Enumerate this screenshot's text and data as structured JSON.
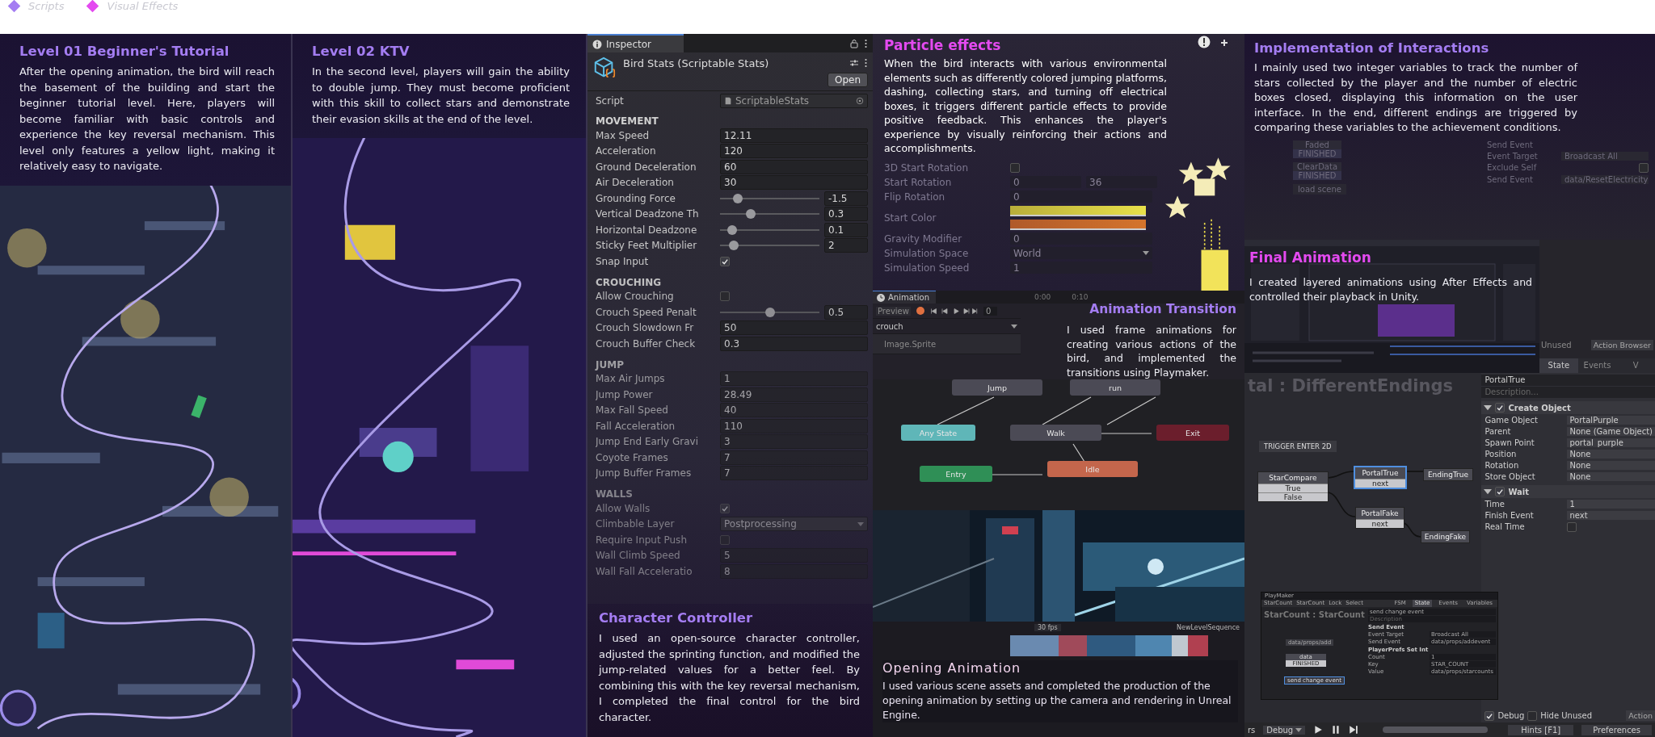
{
  "legend": [
    {
      "label": "Scripts",
      "color": "#a47df2"
    },
    {
      "label": "Visual Effects",
      "color": "#e44af0"
    }
  ],
  "notes": [
    {
      "title": "Level 01 Beginner's Tutorial",
      "color": "#a47df2",
      "body": "After the opening animation, the bird will reach the basement of the building and start the beginner tutorial level. Here, players will become familiar with basic controls and experience the key reversal mechanism. This level only features a yellow light, making it relatively easy to navigate."
    },
    {
      "title": "Level 02 KTV",
      "color": "#a47df2",
      "body": "In the second level, players will gain the ability to double jump. They must become proficient with this skill to collect stars and demonstrate their evasion skills at the end of the level."
    },
    {
      "title": "Character Controller",
      "color": "#a47df2",
      "body": "I used an open-source character controller, adjusted the sprinting function, and modified the jump-related values for a better feel. By combining this with the key reversal mechanism, I completed the final control for the bird character."
    },
    {
      "title": "Particle effects",
      "color": "#e44af0",
      "body": "When the bird interacts with various environmental elements such as differently colored jumping platforms, dashing, collecting stars, and turning off electrical boxes, it triggers different particle effects to provide positive feedback. This enhances the player's experience by visually reinforcing their actions and accomplishments."
    },
    {
      "title": "Animation Transition",
      "color": "#a47df2",
      "body": "I used frame animations for creating various actions of the bird, and implemented the transitions using Playmaker."
    },
    {
      "title": "Opening Animation",
      "color": "#f2d4ee",
      "body": "I used various scene assets and completed the production of the opening animation by setting up the camera and rendering in Unreal Engine."
    },
    {
      "title": "Implementation of Interactions",
      "color": "#a47df2",
      "body": "I mainly used two integer variables to track the number of stars collected by the player and the number of electric boxes closed, displaying this information on the user interface. In the end, different endings are triggered by comparing these variables to the achievement conditions."
    },
    {
      "title": "Final Animation",
      "color": "#e44af0",
      "body": "I created layered animations using After Effects and controlled their playback in Unity."
    }
  ],
  "inspector": {
    "tab": "Inspector",
    "asset": "Bird Stats (Scriptable Stats)",
    "open_button": "Open",
    "script_label": "Script",
    "script_value": "ScriptableStats",
    "groups": [
      {
        "heading": "MOVEMENT",
        "rows": [
          {
            "label": "Max Speed",
            "kind": "field",
            "value": "12.11"
          },
          {
            "label": "Acceleration",
            "kind": "field",
            "value": "120"
          },
          {
            "label": "Ground Deceleration",
            "kind": "field",
            "value": "60"
          },
          {
            "label": "Air Deceleration",
            "kind": "field",
            "value": "30"
          },
          {
            "label": "Grounding Force",
            "kind": "slider",
            "level": 0.18,
            "value": "-1.5"
          },
          {
            "label": "Vertical Deadzone Th",
            "kind": "slider",
            "level": 0.31,
            "value": "0.3"
          },
          {
            "label": "Horizontal Deadzone",
            "kind": "slider",
            "level": 0.12,
            "value": "0.1"
          },
          {
            "label": "Sticky Feet Multiplier",
            "kind": "slider",
            "level": 0.14,
            "value": "2"
          },
          {
            "label": "Snap Input",
            "kind": "checkbox",
            "checked": true
          }
        ]
      },
      {
        "heading": "CROUCHING",
        "rows": [
          {
            "label": "Allow Crouching",
            "kind": "checkbox",
            "checked": false
          },
          {
            "label": "Crouch Speed Penalt",
            "kind": "slider",
            "level": 0.5,
            "value": "0.5"
          },
          {
            "label": "Crouch Slowdown Fr",
            "kind": "field",
            "value": "50"
          },
          {
            "label": "Crouch Buffer Check",
            "kind": "field",
            "value": "0.3"
          }
        ]
      },
      {
        "heading": "JUMP",
        "rows": [
          {
            "label": "Max Air Jumps",
            "kind": "field",
            "value": "1"
          },
          {
            "label": "Jump Power",
            "kind": "field",
            "value": "28.49"
          },
          {
            "label": "Max Fall Speed",
            "kind": "field",
            "value": "40"
          },
          {
            "label": "Fall Acceleration",
            "kind": "field",
            "value": "110"
          },
          {
            "label": "Jump End Early Gravi",
            "kind": "field",
            "value": "3"
          },
          {
            "label": "Coyote Frames",
            "kind": "field",
            "value": "7"
          },
          {
            "label": "Jump Buffer Frames",
            "kind": "field",
            "value": "7"
          }
        ]
      },
      {
        "heading": "WALLS",
        "rows": [
          {
            "label": "Allow Walls",
            "kind": "checkbox",
            "checked": true
          },
          {
            "label": "Climbable Layer",
            "kind": "dropdown",
            "value": "Postprocessing"
          },
          {
            "label": "Require Input Push",
            "kind": "checkbox",
            "checked": false
          },
          {
            "label": "Wall Climb Speed",
            "kind": "field",
            "value": "5"
          },
          {
            "label": "Wall Fall Acceleratio",
            "kind": "field",
            "value": "8"
          }
        ]
      }
    ]
  },
  "particle_rows": [
    {
      "label": "3D Start Rotation",
      "kind": "checkbox",
      "checked": false
    },
    {
      "label": "Start Rotation",
      "kind": "range",
      "value": "0",
      "value_2": "36"
    },
    {
      "label": "Flip Rotation",
      "kind": "field",
      "value": "0"
    },
    {
      "label": "Start Color",
      "kind": "gradient"
    },
    {
      "label": "Gravity Modifier",
      "kind": "field",
      "value": "0"
    },
    {
      "label": "Simulation Space",
      "kind": "dropdown",
      "value": "World"
    },
    {
      "label": "Simulation Speed",
      "kind": "field",
      "value": "1"
    }
  ],
  "animation_window": {
    "tab": "Animation",
    "preview": "Preview",
    "frame": "0",
    "clip": "crouch",
    "property": "Image.Sprite",
    "ticks": [
      "0:00",
      "0:10"
    ],
    "states": [
      {
        "label": "Jump",
        "color": "#4b4a55"
      },
      {
        "label": "run",
        "color": "#4b4a55"
      },
      {
        "label": "Any State",
        "color": "#5fb6b8"
      },
      {
        "label": "Walk",
        "color": "#4b4a55"
      },
      {
        "label": "Exit",
        "color": "#6b1e2c"
      },
      {
        "label": "Entry",
        "color": "#2f8f56"
      },
      {
        "label": "Idle",
        "color": "#c4664c"
      }
    ]
  },
  "sequencer": {
    "fps": "30 fps",
    "title": "NewLevelSequence"
  },
  "interaction_graph": {
    "nodes": [
      {
        "label": "Faded",
        "event": "FINISHED"
      },
      {
        "label": "ClearData",
        "event": "FINISHED"
      }
    ],
    "action": "load scene",
    "action_title": "Send Event",
    "rows": [
      {
        "label": "Event Target",
        "value": "Broadcast All"
      },
      {
        "label": "Exclude Self",
        "kind": "checkbox",
        "checked": false
      },
      {
        "label": "Send Event",
        "value": "data/ResetElectricity"
      }
    ]
  },
  "action_panel": {
    "hide_label": "Unused",
    "browser": "Action Browser",
    "tabs": [
      {
        "label": "State",
        "selected": true
      },
      {
        "label": "Events",
        "selected": false
      },
      {
        "label": "V",
        "selected": false
      }
    ]
  },
  "playmaker": {
    "fsm_title": "tal : DifferentEndings",
    "trigger": "TRIGGER ENTER 2D",
    "nodes": [
      {
        "label": "StarCompare",
        "events": [
          "True",
          "False"
        ],
        "selected": false
      },
      {
        "label": "PortalTrue",
        "events": [
          "next"
        ],
        "selected": true
      },
      {
        "label": "EndingTrue",
        "selected": false
      },
      {
        "label": "PortalFake",
        "events": [
          "next"
        ],
        "selected": false
      },
      {
        "label": "EndingFake",
        "selected": false
      }
    ],
    "state_name": "PortalTrue",
    "description": "Description...",
    "actions": [
      {
        "name": "Create Object",
        "enabled": true,
        "rows": [
          {
            "label": "Game Object",
            "value": "PortalPurple"
          },
          {
            "label": "Parent",
            "value": "None (Game Object)"
          },
          {
            "label": "Spawn Point",
            "value": "portal_purple"
          },
          {
            "label": "Position",
            "value": "None"
          },
          {
            "label": "Rotation",
            "value": "None"
          },
          {
            "label": "Store Object",
            "value": "None"
          }
        ]
      },
      {
        "name": "Wait",
        "enabled": true,
        "rows": [
          {
            "label": "Time",
            "value": "1"
          },
          {
            "label": "Finish Event",
            "value": "next"
          },
          {
            "label": "Real Time",
            "kind": "checkbox",
            "checked": false
          }
        ]
      }
    ],
    "debug": {
      "label": "Debug",
      "checked": true
    },
    "hide_unused": {
      "label": "Hide Unused",
      "checked": false
    },
    "action_button": "Action",
    "left_tail": "rs",
    "debug_menu": "Debug",
    "hints": "Hints [F1]",
    "preferences": "Preferences",
    "mini": {
      "title": "PlayMaker",
      "toolbar": [
        "StarCount",
        "StarCount",
        "Lock",
        "Select"
      ],
      "tabs": [
        {
          "label": "FSM",
          "selected": false
        },
        {
          "label": "State",
          "selected": true
        },
        {
          "label": "Events",
          "selected": false
        },
        {
          "label": "Variables",
          "selected": false
        }
      ],
      "fsm_title": "StarCount : StarCount",
      "start": "data/props/add",
      "node": "data",
      "node_event": "FINISHED",
      "action_node": "send change event",
      "state_name": "send change event",
      "description": "Description",
      "actions": [
        {
          "name": "Send Event",
          "rows": [
            {
              "label": "Event Target",
              "value": "Broadcast All"
            },
            {
              "label": "Send Event",
              "value": "data/props/addevent"
            }
          ]
        },
        {
          "name": "PlayerPrefs Set Int",
          "rows": [
            {
              "label": "Count",
              "value": "1"
            },
            {
              "label": "Key",
              "value": "STAR_COUNT"
            },
            {
              "label": "Value",
              "value": "data/props/starcounts"
            }
          ]
        }
      ]
    }
  }
}
